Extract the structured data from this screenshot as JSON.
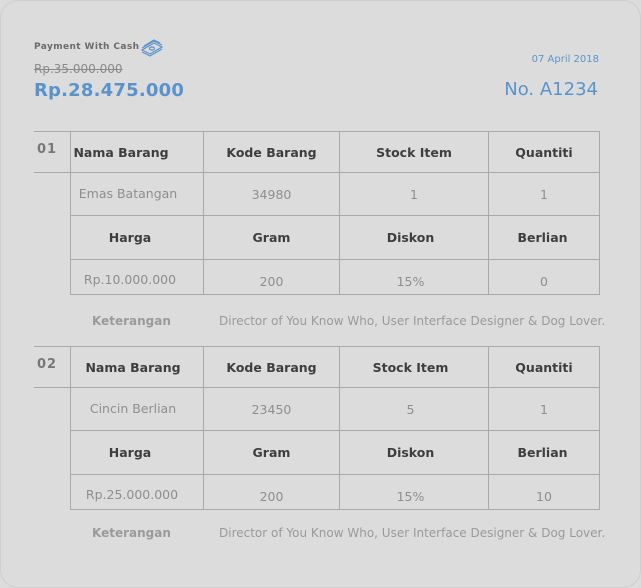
{
  "header": {
    "payment_label": "Payment With Cash",
    "payment_icon": "cash-stack-icon",
    "original_price": "Rp.35.000.000",
    "final_price": "Rp.28.475.000",
    "date": "07 April 2018",
    "invoice_number": "No. A1234"
  },
  "colors": {
    "accent": "#5a93cc",
    "background": "#dcdcdc",
    "grid_line": "#a9a9a9",
    "header_text": "#3e3e3e",
    "value_text": "#8e8e8e"
  },
  "items": [
    {
      "index": "01",
      "headers_row1": [
        "Nama Barang",
        "Kode Barang",
        "Stock Item",
        "Quantiti"
      ],
      "values_row1": [
        "Emas Batangan",
        "34980",
        "1",
        "1"
      ],
      "headers_row2": [
        "Harga",
        "Gram",
        "Diskon",
        "Berlian"
      ],
      "values_row2": [
        "Rp.10.000.000",
        "200",
        "15%",
        "0"
      ],
      "note_label": "Keterangan",
      "note_value": "Director of You Know Who, User Interface Designer & Dog Lover."
    },
    {
      "index": "02",
      "headers_row1": [
        "Nama Barang",
        "Kode Barang",
        "Stock Item",
        "Quantiti"
      ],
      "values_row1": [
        "Cincin Berlian",
        "23450",
        "5",
        "1"
      ],
      "headers_row2": [
        "Harga",
        "Gram",
        "Diskon",
        "Berlian"
      ],
      "values_row2": [
        "Rp.25.000.000",
        "200",
        "15%",
        "10"
      ],
      "note_label": "Keterangan",
      "note_value": "Director of You Know Who, User Interface Designer & Dog Lover."
    }
  ]
}
